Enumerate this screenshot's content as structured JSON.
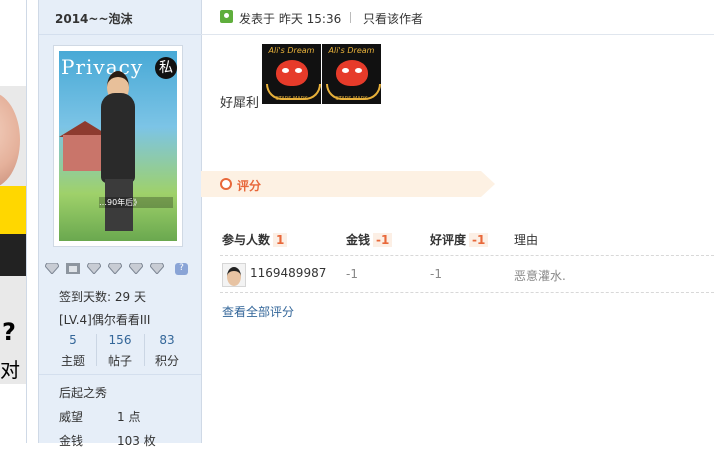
{
  "ad": {
    "question": "?",
    "text": "对",
    "paw_icon": "paw-icon"
  },
  "sidebar": {
    "username": "2014~~泡沫",
    "avatar": {
      "title": "Privacy",
      "seal": "私",
      "caption": "…90年后》"
    },
    "medal_icons": [
      "diamond-icon",
      "diamond-icon",
      "diamond-icon",
      "diamond-icon",
      "diamond-icon",
      "diamond-icon",
      "question-icon"
    ],
    "checkin": "签到天数: 29 天",
    "level": "[LV.4]偶尔看看III",
    "stats": [
      {
        "num": "5",
        "label": "主题"
      },
      {
        "num": "156",
        "label": "帖子"
      },
      {
        "num": "83",
        "label": "积分"
      }
    ],
    "honor": "后起之秀",
    "props": [
      {
        "k": "威望",
        "v": "1 点"
      },
      {
        "k": "金钱",
        "v": "103 枚"
      }
    ]
  },
  "post": {
    "posted_label": "发表于  昨天 15:36",
    "only_author": "只看该作者",
    "text": "好犀利",
    "sticker": {
      "top_text": "Ali's Dream",
      "bottom_text": "STARS   MARK"
    }
  },
  "rating": {
    "title": "评分",
    "headers": {
      "participants": "参与人数",
      "participants_count": "1",
      "money": "金钱",
      "money_total": "-1",
      "rating": "好评度",
      "rating_total": "-1",
      "reason": "理由"
    },
    "row": {
      "user": "1169489987",
      "money": "-1",
      "rating": "-1",
      "reason": "恶意灌水."
    },
    "view_all": "查看全部评分"
  },
  "colors": {
    "sidebar_bg": "#e6eef8",
    "accent_orange": "#e8683a",
    "link_blue": "#336699"
  }
}
